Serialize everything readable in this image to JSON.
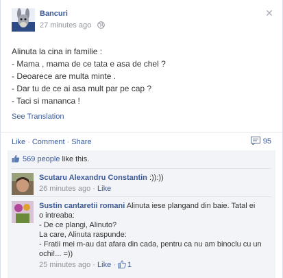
{
  "post": {
    "page_name": "Bancuri",
    "time": "27 minutes ago",
    "body_lines": [
      "Alinuta la cina in familie :",
      "- Mama , mama de ce tata e asa de chel ?",
      "- Deoarece are multa minte .",
      "- Dar tu de ce ai asa mult par pe cap ?",
      "- Taci si mananca !"
    ],
    "see_translation": "See Translation"
  },
  "actions": {
    "like": "Like",
    "comment": "Comment",
    "share": "Share",
    "separator": "·",
    "comments_count": "95"
  },
  "likes": {
    "people_link": "569 people",
    "suffix": " like this."
  },
  "comments": [
    {
      "author": "Scutaru Alexandru Constantin",
      "text": " :)):))",
      "time": "26 minutes ago",
      "like": "Like"
    },
    {
      "author": "Sustin cantaretii romani",
      "text_lines": [
        " Alinuta iese plangand din baie. Tatal ei",
        "o intreaba:",
        "- De ce plangi, Alinuto?",
        "La care, Alinuta raspunde:",
        "- Fratii mei m-au dat afara din cada, pentru ca nu am binoclu cu un",
        "ochi!... =))"
      ],
      "time": "25 minutes ago",
      "like": "Like",
      "like_count": "1"
    }
  ],
  "colors": {
    "link": "#3b5998",
    "meta": "#90949c",
    "ufi_bg": "#f2f4f7"
  },
  "icons": [
    "donkey-avatar-icon",
    "globe-icon",
    "close-icon",
    "comment-bubble-icon",
    "thumbs-up-icon"
  ]
}
